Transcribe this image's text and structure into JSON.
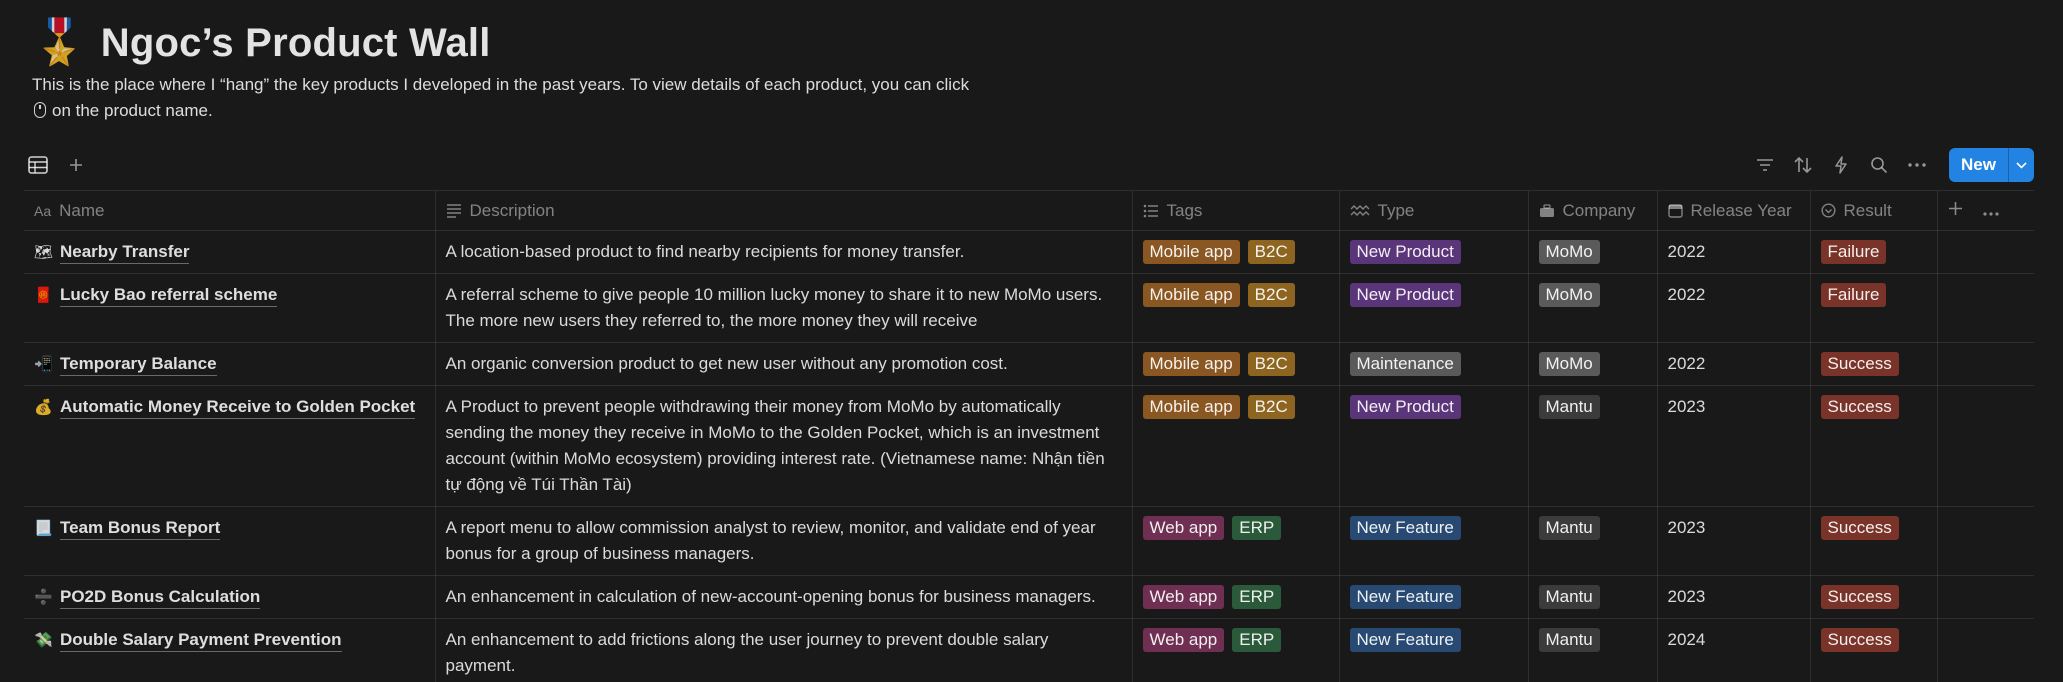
{
  "page": {
    "emoji": "🎖️",
    "title": "Ngoc’s Product Wall",
    "intro_line1": "This is the place where I “hang” the key products I developed in the past years. To view details of each product, you can click",
    "intro_line2": "on the product name."
  },
  "toolbar": {
    "view_icon": "table-icon",
    "new_label": "New",
    "icons": [
      "add-view-icon",
      "filter-icon",
      "sort-icon",
      "automation-icon",
      "search-icon",
      "more-icon",
      "chevron-down-icon"
    ]
  },
  "columns": {
    "name": "Name",
    "description": "Description",
    "tags": "Tags",
    "type": "Type",
    "company": "Company",
    "release_year": "Release Year",
    "result": "Result",
    "name_icon": "Aa"
  },
  "colors": {
    "accent": "#2383e2",
    "background": "#191919",
    "tag_mobile_app": "#8a5622",
    "tag_b2c": "#8d6420",
    "tag_web_app": "#6e2f52",
    "tag_erp": "#2b5a3a",
    "type_new_product": "#5a3579",
    "type_new_feature": "#284a72",
    "type_maintenance": "#5a5a5a",
    "result": "#7a3329"
  },
  "rows": [
    {
      "icon": "🗺",
      "name": "Nearby Transfer",
      "description": "A location-based product to find nearby recipients for money transfer.",
      "tags": [
        "Mobile app",
        "B2C"
      ],
      "type": "New Product",
      "company": "MoMo",
      "year": "2022",
      "result": "Failure"
    },
    {
      "icon": "🧧",
      "name": "Lucky Bao referral scheme",
      "description": "A referral scheme to give people 10 million lucky money to share it to new MoMo users. The more new users they referred to, the more money they will receive",
      "tags": [
        "Mobile app",
        "B2C"
      ],
      "type": "New Product",
      "company": "MoMo",
      "year": "2022",
      "result": "Failure"
    },
    {
      "icon": "📲",
      "name": "Temporary Balance",
      "description": "An organic conversion product to get new user without any promotion cost.",
      "tags": [
        "Mobile app",
        "B2C"
      ],
      "type": "Maintenance",
      "company": "MoMo",
      "year": "2022",
      "result": "Success"
    },
    {
      "icon": "💰",
      "name": "Automatic Money Receive to Golden Pocket",
      "description": "A Product to prevent people withdrawing their money from MoMo by automatically sending the money they receive in MoMo to the Golden Pocket, which is an investment account (within MoMo ecosystem) providing interest rate. (Vietnamese name: Nhận tiền tự động về Túi Thần Tài)",
      "tags": [
        "Mobile app",
        "B2C"
      ],
      "type": "New Product",
      "company": "Mantu",
      "year": "2023",
      "result": "Success"
    },
    {
      "icon": "📃",
      "name": "Team Bonus Report",
      "description": "A report menu to allow commission analyst to review, monitor, and validate end of year bonus for a group of business managers.",
      "tags": [
        "Web app",
        "ERP"
      ],
      "type": "New Feature",
      "company": "Mantu",
      "year": "2023",
      "result": "Success"
    },
    {
      "icon": "➗",
      "name": "PO2D Bonus Calculation",
      "description": "An enhancement in calculation of new-account-opening bonus for business managers.",
      "tags": [
        "Web app",
        "ERP"
      ],
      "type": "New Feature",
      "company": "Mantu",
      "year": "2023",
      "result": "Success"
    },
    {
      "icon": "💸",
      "name": "Double Salary Payment Prevention",
      "description": "An enhancement to add frictions along the user journey to prevent double salary payment.",
      "tags": [
        "Web app",
        "ERP"
      ],
      "type": "New Feature",
      "company": "Mantu",
      "year": "2024",
      "result": "Success"
    }
  ]
}
